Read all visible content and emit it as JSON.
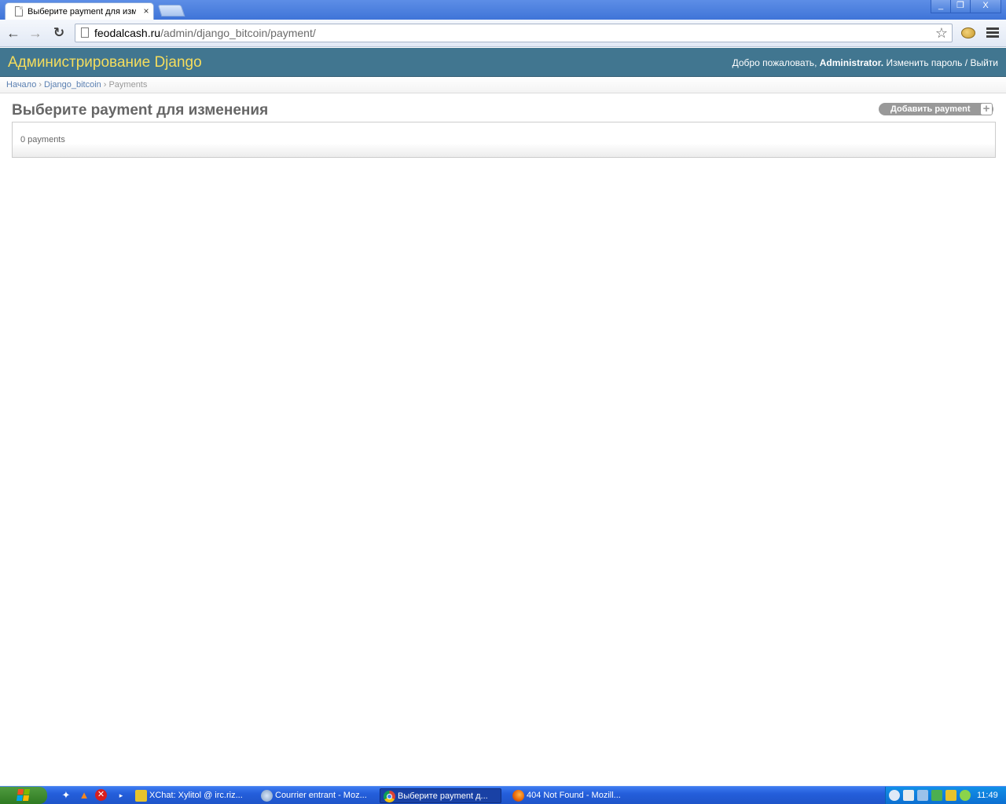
{
  "browser": {
    "tab_title": "Выберите payment для изм",
    "tab_close_glyph": "×",
    "back_glyph": "←",
    "forward_glyph": "→",
    "reload_glyph": "↻",
    "star_glyph": "☆",
    "url_host": "feodalcash.ru",
    "url_path": "/admin/django_bitcoin/payment/",
    "window": {
      "min_glyph": "_",
      "max_glyph": "❐",
      "close_glyph": "X"
    }
  },
  "admin": {
    "site_name": "Администрирование Django",
    "user_tools": {
      "welcome": "Добро пожаловать,",
      "username": "Administrator",
      "username_suffix": ".",
      "change_password": "Изменить пароль",
      "separator": "/",
      "logout": "Выйти"
    },
    "breadcrumbs": {
      "home": "Начало",
      "app": "Django_bitcoin",
      "current": "Payments",
      "separator": "›"
    },
    "page_title": "Выберите payment для изменения",
    "add_button_label": "Добавить payment",
    "add_button_glyph": "+",
    "paginator_text": "0 payments"
  },
  "taskbar": {
    "tasks": [
      {
        "label": "XChat: Xylitol @ irc.riz..."
      },
      {
        "label": "Courrier entrant - Moz..."
      },
      {
        "label": "Выберите payment д..."
      },
      {
        "label": "404 Not Found - Mozill..."
      }
    ],
    "active_task_index": 2,
    "quick_launch_more_glyph": "▸",
    "clock": "11:49"
  },
  "colors": {
    "header_bg": "#417690",
    "site_name": "#f5dd5d",
    "link": "#5b80b2",
    "taskbar": "#245edb"
  }
}
